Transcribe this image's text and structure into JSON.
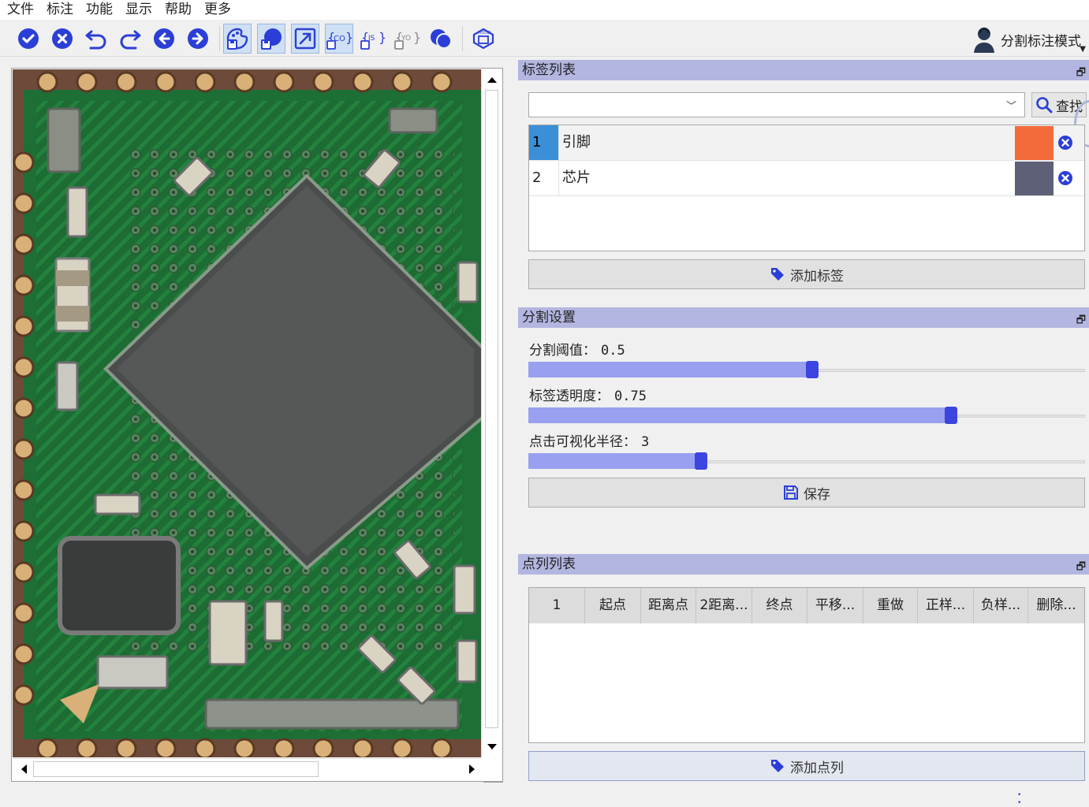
{
  "menu": [
    "文件",
    "标注",
    "功能",
    "显示",
    "帮助",
    "更多"
  ],
  "toolbar": {
    "buttons": [
      {
        "icon": "check-circle-icon"
      },
      {
        "icon": "x-circle-icon"
      },
      {
        "icon": "undo-icon"
      },
      {
        "icon": "redo-icon"
      },
      {
        "icon": "arrow-left-icon"
      },
      {
        "icon": "arrow-right-icon"
      },
      {
        "icon": "save-palette-icon"
      },
      {
        "icon": "save-half-circle-icon"
      },
      {
        "icon": "export-image-icon"
      },
      {
        "icon": "save-coco-icon"
      },
      {
        "icon": "save-json-icon"
      },
      {
        "icon": "save-yolo-icon"
      },
      {
        "icon": "dual-circle-icon"
      },
      {
        "icon": "model-icon"
      }
    ],
    "mode_label": "分割标注模式"
  },
  "labels_panel": {
    "title": "标签列表",
    "search_value": "",
    "find_button": "查找",
    "labels": [
      {
        "index": "1",
        "name": "引脚",
        "color": "#f36b3b"
      },
      {
        "index": "2",
        "name": "芯片",
        "color": "#5e6078"
      }
    ],
    "add_button": "添加标签"
  },
  "segment_panel": {
    "title": "分割设置",
    "threshold_label": "分割阈值：",
    "threshold_value": "0.5",
    "threshold_fraction": 0.5,
    "opacity_label": "标签透明度：",
    "opacity_value": "0.75",
    "opacity_fraction": 0.75,
    "radius_label": "点击可视化半径：",
    "radius_value": "3",
    "radius_fraction": 0.3,
    "save_button": "保存"
  },
  "points_panel": {
    "title": "点列列表",
    "columns": [
      "1",
      "起点",
      "距离点",
      "2距离...",
      "终点",
      "平移...",
      "重做",
      "正样...",
      "负样...",
      "删除..."
    ],
    "add_button": "添加点列"
  }
}
